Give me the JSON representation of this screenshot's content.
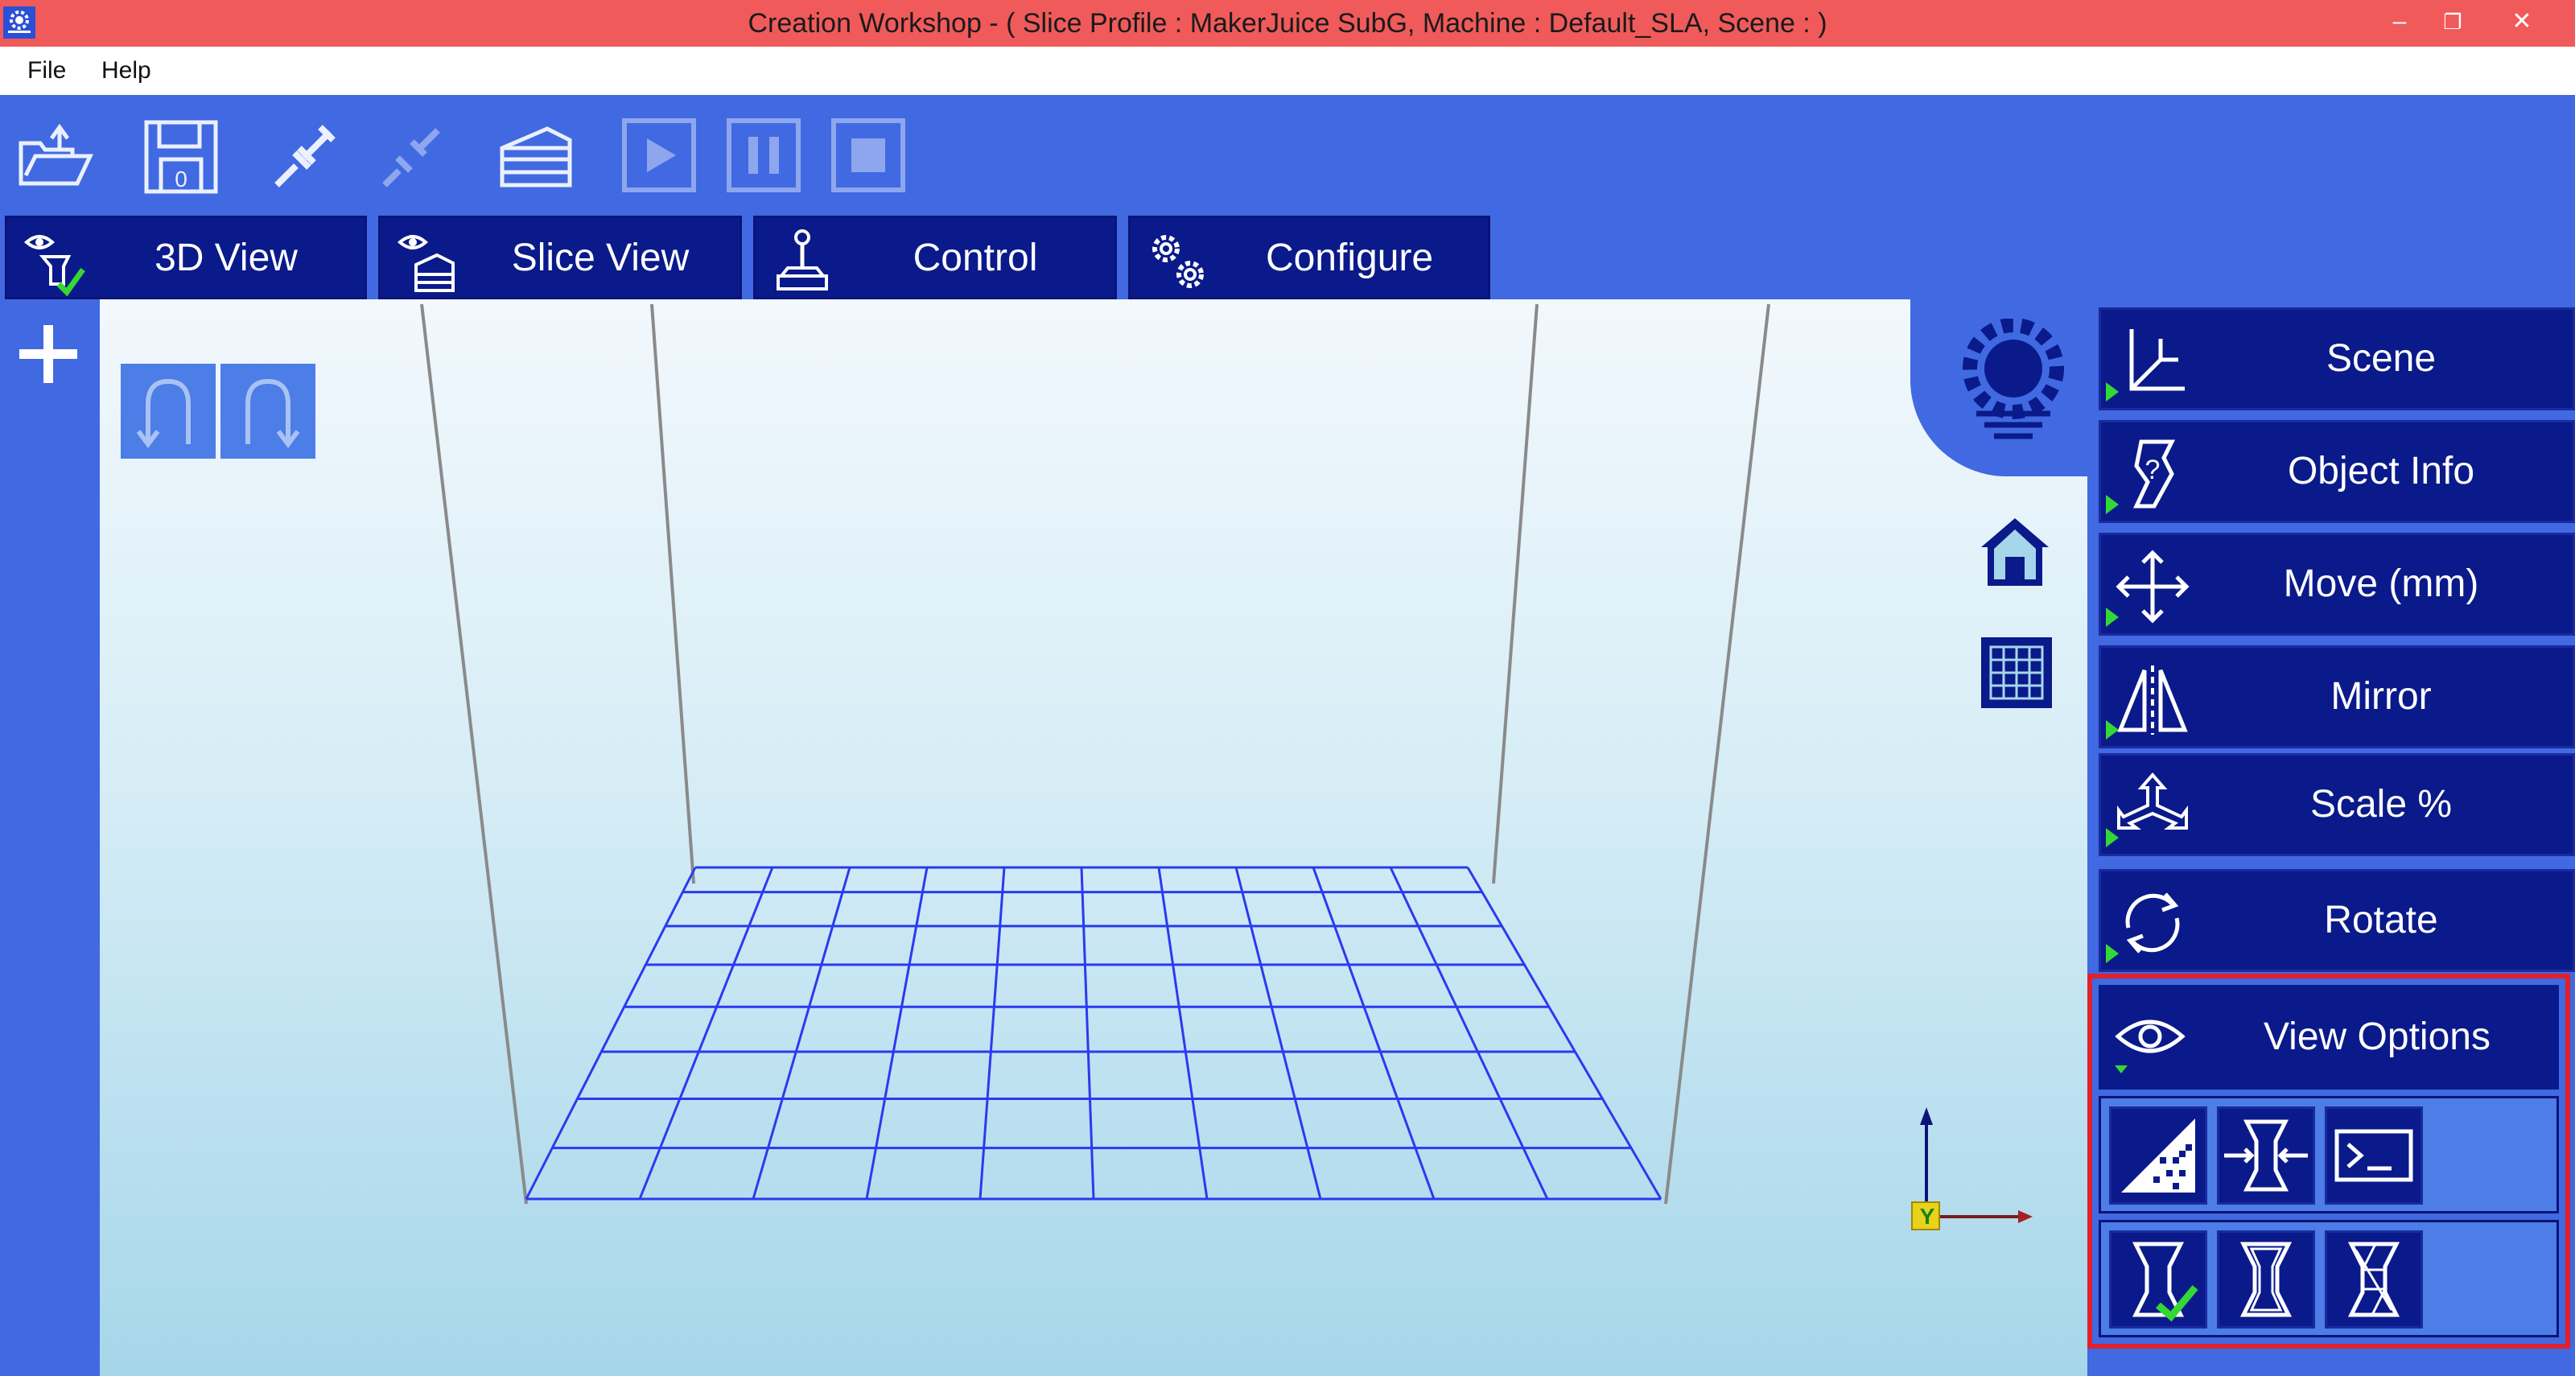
{
  "window": {
    "title": "Creation Workshop -   ( Slice Profile : MakerJuice SubG, Machine : Default_SLA, Scene : )",
    "minimize": "–",
    "restore": "❐",
    "close": "✕"
  },
  "menu": {
    "file": "File",
    "help": "Help"
  },
  "toolbar": {
    "icons": [
      "open-icon",
      "save-icon",
      "connect-icon",
      "disconnect-icon",
      "slice-icon",
      "play-icon",
      "pause-icon",
      "stop-icon"
    ]
  },
  "tabs": [
    {
      "label": "3D View",
      "icon": "eye-3d-view-icon"
    },
    {
      "label": "Slice View",
      "icon": "eye-slice-icon"
    },
    {
      "label": "Control",
      "icon": "joystick-icon"
    },
    {
      "label": "Configure",
      "icon": "gears-icon"
    }
  ],
  "right_panel": {
    "items": [
      {
        "label": "Scene",
        "icon": "axes-icon"
      },
      {
        "label": "Object Info",
        "icon": "object-info-icon"
      },
      {
        "label": "Move (mm)",
        "icon": "move-arrows-icon"
      },
      {
        "label": "Mirror",
        "icon": "mirror-icon"
      },
      {
        "label": "Scale %",
        "icon": "scale-icon"
      },
      {
        "label": "Rotate",
        "icon": "rotate-icon"
      }
    ],
    "view_options": {
      "label": "View Options",
      "icon": "eye-icon"
    }
  },
  "viewport": {
    "axis_label": "Y"
  },
  "colors": {
    "titlebar": "#f05a5a",
    "background": "#4169e1",
    "button_dark": "#0a1a8a",
    "highlight_border": "#e0202c",
    "grid": "#2a3af0",
    "check": "#34d834"
  }
}
